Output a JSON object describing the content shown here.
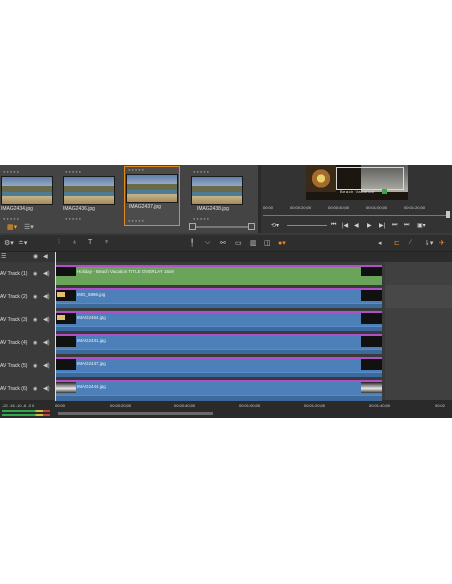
{
  "library": {
    "items": [
      {
        "name": "IMAG2434.jpg"
      },
      {
        "name": "IMAG2436.jpg"
      },
      {
        "name": "IMAG2437.jpg",
        "selected": true
      },
      {
        "name": "IMAG2438.jpg"
      }
    ]
  },
  "preview": {
    "caption": "Beach Vacation",
    "ruler": [
      "00:00",
      "00:00:20;00",
      "00:00:40;00",
      "00:01:00;00",
      "00:01:20;00"
    ]
  },
  "tracks": [
    {
      "name": "AV Track (1)",
      "clip": "Holiday - Beach Vacation TITLE OVERLAY 16x9",
      "type": "title"
    },
    {
      "name": "AV Track (2)",
      "clip": "IMG_5896.jpg",
      "type": "video"
    },
    {
      "name": "AV Track (3)",
      "clip": "IMAG2464.jpg",
      "type": "video"
    },
    {
      "name": "AV Track (4)",
      "clip": "IMAG2431.jpg",
      "type": "video"
    },
    {
      "name": "AV Track (5)",
      "clip": "IMAG2437.jpg",
      "type": "video"
    },
    {
      "name": "AV Track (6)",
      "clip": "IMAG2444.jpg",
      "type": "video"
    }
  ],
  "bottom": {
    "meter_scale": "-22  -16  -10   -6  -3   0",
    "ruler": [
      "00:00",
      "00:00:20;00",
      "00:00:40;00",
      "00:01:00;00",
      "00:01:20;00",
      "00:01:40;00",
      "00:02"
    ]
  },
  "colors": {
    "title_clip": "#6aa35a",
    "video_clip": "#4d7fb8",
    "clip_border": "#b04fc8",
    "accent": "#f08a1e"
  }
}
